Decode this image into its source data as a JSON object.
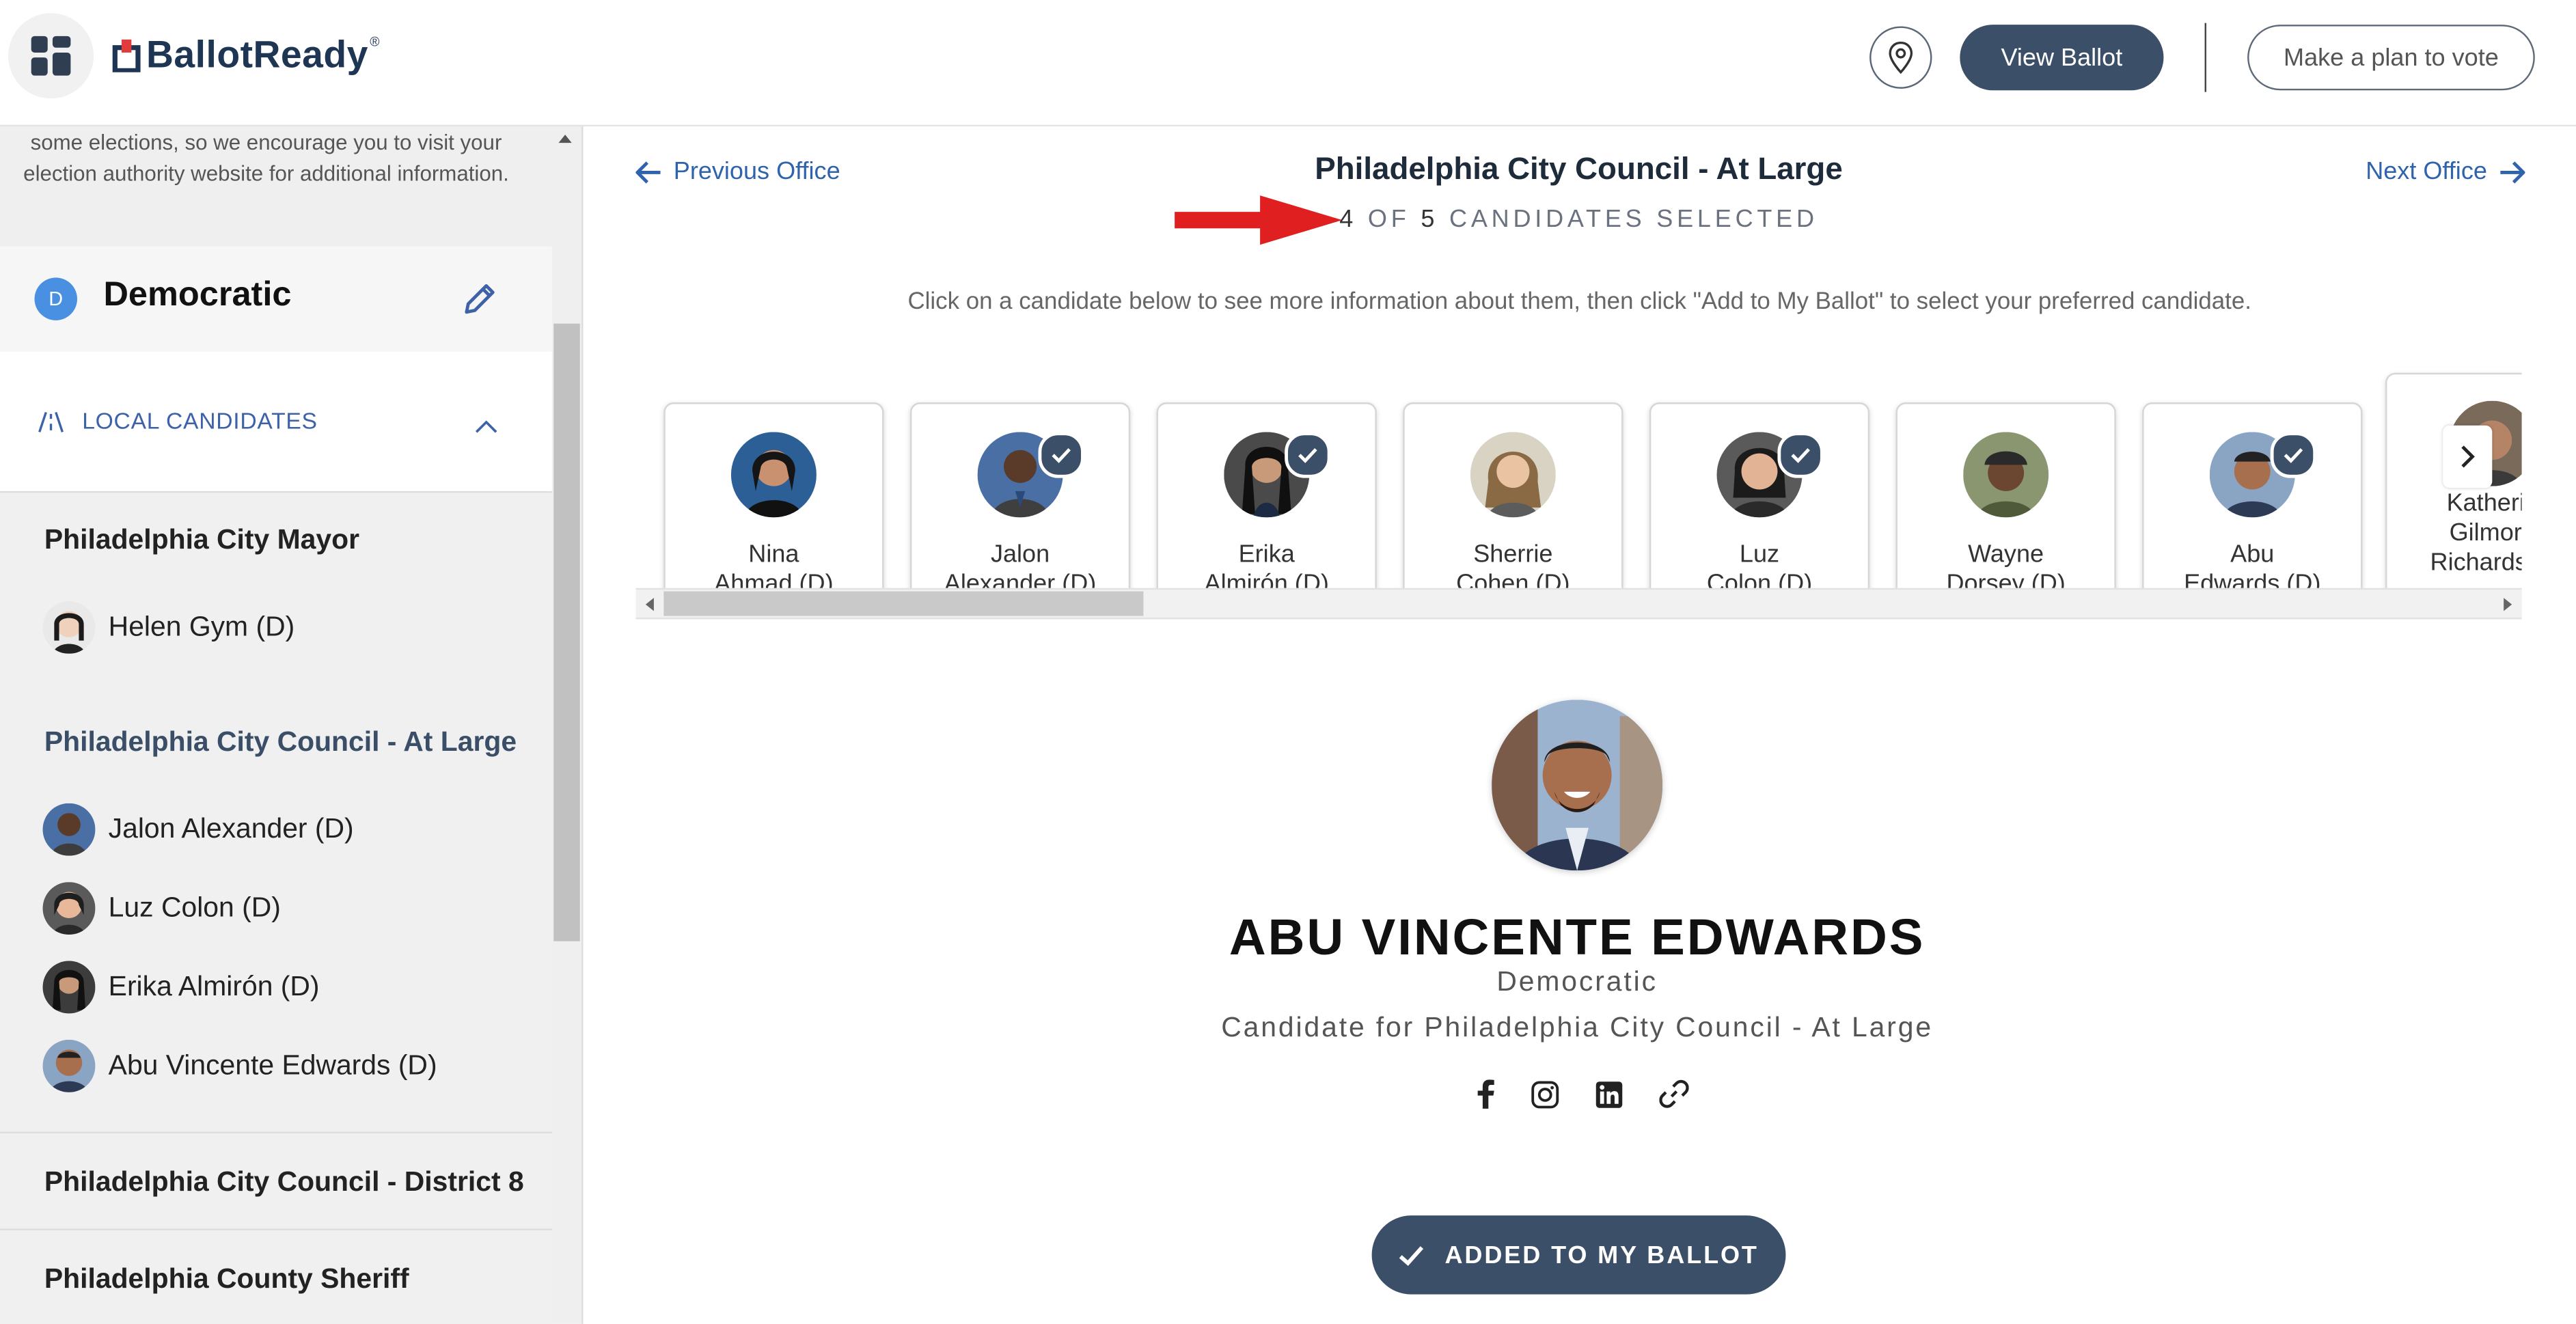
{
  "app": {
    "brand": "BallotReady",
    "brand_mark": "®"
  },
  "header": {
    "view_ballot_label": "View Ballot",
    "plan_label": "Make a plan to vote"
  },
  "sidebar": {
    "notice": "some elections, so we encourage you to visit your election authority website for additional information.",
    "party": {
      "badge": "D",
      "name": "Democratic"
    },
    "local_label": "LOCAL CANDIDATES",
    "offices": [
      {
        "title": "Philadelphia City Mayor",
        "candidates": [
          "Helen Gym (D)"
        ]
      },
      {
        "title": "Philadelphia City Council - At Large",
        "candidates": [
          "Jalon Alexander (D)",
          "Luz Colon (D)",
          "Erika Almirón (D)",
          "Abu Vincente Edwards (D)"
        ]
      },
      {
        "title": "Philadelphia City Council - District 8",
        "candidates": []
      },
      {
        "title": "Philadelphia County Sheriff",
        "candidates": []
      }
    ]
  },
  "main": {
    "prev_label": "Previous Office",
    "next_label": "Next Office",
    "office_title": "Philadelphia City Council - At Large",
    "selected_num": "4",
    "selected_of": "OF",
    "selected_total": "5",
    "selected_suffix": "CANDIDATES SELECTED",
    "instructions": "Click on a candidate below to see more information about them, then click \"Add to My Ballot\" to select your preferred candidate.",
    "cards": [
      {
        "name": "Nina\nAhmad (D)",
        "selected": false,
        "color": "#2b5f95"
      },
      {
        "name": "Jalon\nAlexander (D)",
        "selected": true,
        "color": "#4a6fa5"
      },
      {
        "name": "Erika\nAlmirón (D)",
        "selected": true,
        "color": "#3c3c3c"
      },
      {
        "name": "Sherrie\nCohen (D)",
        "selected": false,
        "color": "#c9b79a"
      },
      {
        "name": "Luz\nColon (D)",
        "selected": true,
        "color": "#5a5a5a"
      },
      {
        "name": "Wayne\nDorsey (D)",
        "selected": false,
        "color": "#6d7a5a"
      },
      {
        "name": "Abu\nEdwards (D)",
        "selected": true,
        "color": "#8aa4c4"
      },
      {
        "name": "Katheri\nGilmor\nRichardso",
        "selected": false,
        "color": "#7a6a5a"
      }
    ],
    "profile": {
      "name": "ABU VINCENTE EDWARDS",
      "party": "Democratic",
      "office": "Candidate for Philadelphia City Council - At Large"
    },
    "added_label": "ADDED TO MY BALLOT"
  },
  "colors": {
    "primary": "#3b5068",
    "link": "#2f64ad",
    "accent_arrow": "#e02020"
  }
}
